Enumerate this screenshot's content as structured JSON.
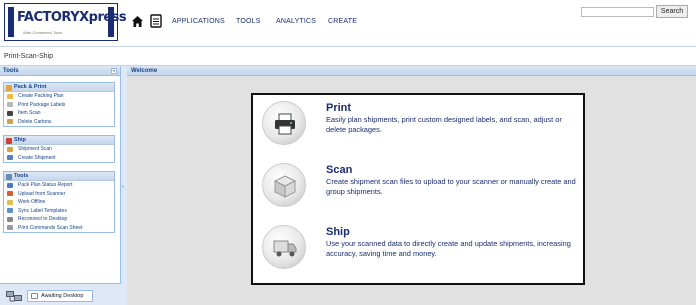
{
  "header": {
    "logo_text": "FACTORYXpress",
    "logo_tagline": "Web-Connected Tools",
    "nav": [
      "APPLICATIONS",
      "TOOLS",
      "ANALYTICS",
      "CREATE"
    ],
    "search_placeholder": "",
    "search_button": "Search"
  },
  "breadcrumb": "Print-Scan-Ship",
  "tools": {
    "title": "Tools",
    "groups": [
      {
        "title": "Pack & Print",
        "items": [
          "Create Packing Plan",
          "Print Package Labels",
          "Item Scan",
          "Delete Cartons"
        ]
      },
      {
        "title": "Ship",
        "items": [
          "Shipment Scan",
          "Create Shipment"
        ]
      },
      {
        "title": "Tools",
        "items": [
          "Pack Plan Status Report",
          "Upload from Scanner",
          "Work Offline",
          "Sync Label Templates",
          "Reconnect to Desktop",
          "Print Commands Scan Sheet"
        ]
      }
    ]
  },
  "status": {
    "label": "Awaiting Desktop"
  },
  "main": {
    "title": "Welcome",
    "features": [
      {
        "title": "Print",
        "desc": "Easily plan shipments, print custom designed labels, and scan, adjust or delete packages."
      },
      {
        "title": "Scan",
        "desc": "Create shipment scan files to upload to your scanner or manually create and group shipments."
      },
      {
        "title": "Ship",
        "desc": "Use your scanned data to directly create and update shipments, increasing accuracy, saving time and money."
      }
    ]
  },
  "colors": {
    "brand": "#1a2d72",
    "panel_border": "#99bbe8",
    "panel_header": "#15428b"
  }
}
